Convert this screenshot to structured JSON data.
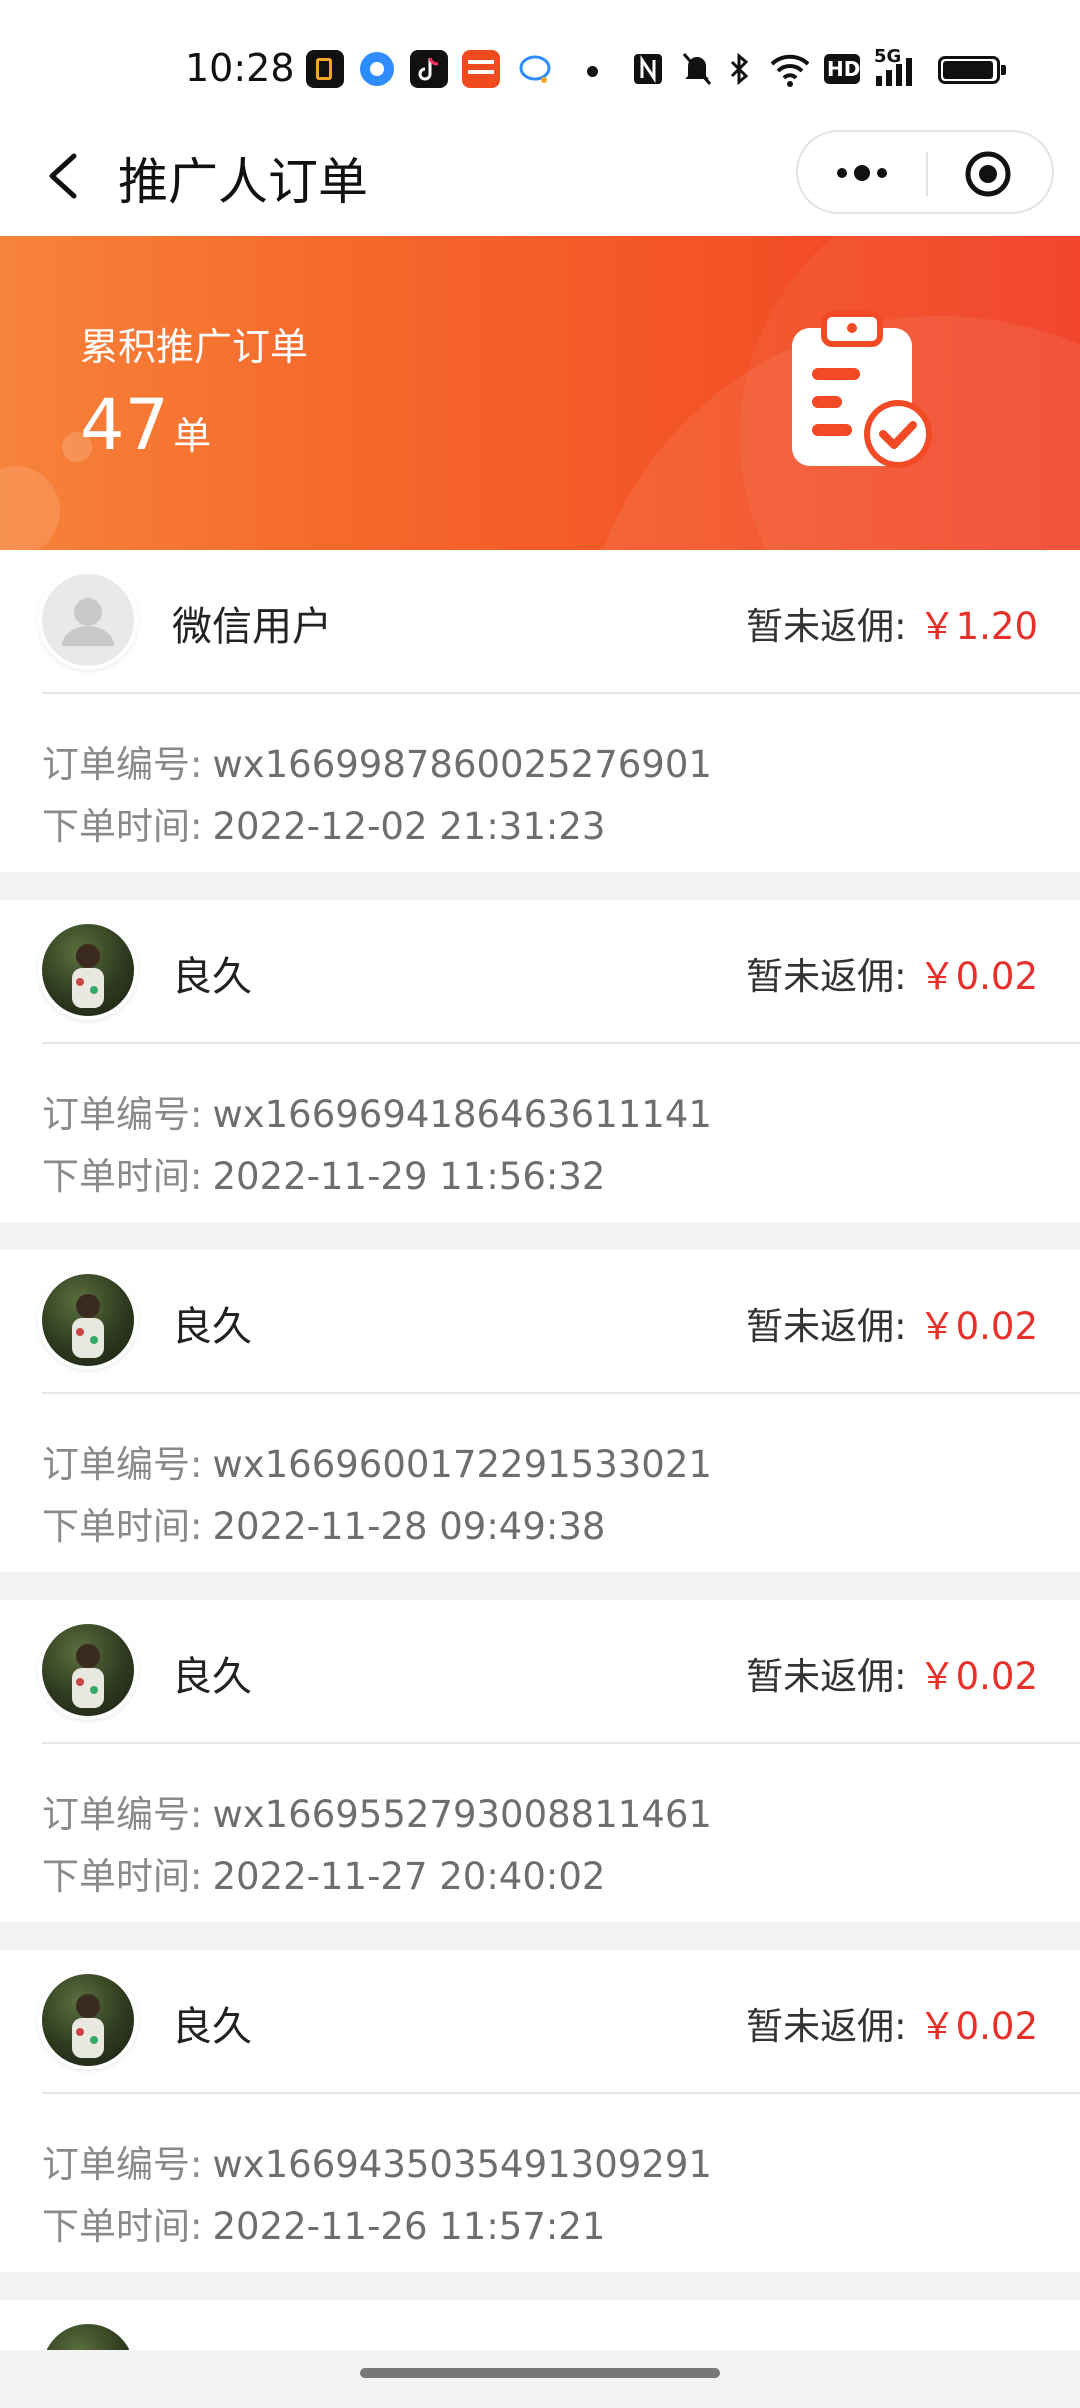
{
  "status_bar": {
    "time": "10:28",
    "icons": [
      "notification-app-icon",
      "browser-app-icon",
      "tiktok-app-icon",
      "bank-app-icon",
      "chat-app-icon",
      "dot-icon",
      "nfc-icon",
      "mute-icon",
      "bluetooth-icon",
      "wifi-icon",
      "hd-icon",
      "signal-5g-icon",
      "battery-icon"
    ],
    "hd_label": "HD",
    "signal_label": "5G"
  },
  "navbar": {
    "title": "推广人订单"
  },
  "banner": {
    "label": "累积推广订单",
    "count": "47",
    "unit": "单"
  },
  "orders": [
    {
      "user": "微信用户",
      "commission_label": "暂未返佣:",
      "amount": "￥1.20",
      "order_label": "订单编号:",
      "order_no": "wx1669987860025276901",
      "time_label": "下单时间:",
      "time": "2022-12-02 21:31:23",
      "avatar": "default"
    },
    {
      "user": "良久",
      "commission_label": "暂未返佣:",
      "amount": "￥0.02",
      "order_label": "订单编号:",
      "order_no": "wx1669694186463611141",
      "time_label": "下单时间:",
      "time": "2022-11-29 11:56:32",
      "avatar": "photo"
    },
    {
      "user": "良久",
      "commission_label": "暂未返佣:",
      "amount": "￥0.02",
      "order_label": "订单编号:",
      "order_no": "wx1669600172291533021",
      "time_label": "下单时间:",
      "time": "2022-11-28 09:49:38",
      "avatar": "photo"
    },
    {
      "user": "良久",
      "commission_label": "暂未返佣:",
      "amount": "￥0.02",
      "order_label": "订单编号:",
      "order_no": "wx1669552793008811461",
      "time_label": "下单时间:",
      "time": "2022-11-27 20:40:02",
      "avatar": "photo"
    },
    {
      "user": "良久",
      "commission_label": "暂未返佣:",
      "amount": "￥0.02",
      "order_label": "订单编号:",
      "order_no": "wx1669435035491309291",
      "time_label": "下单时间:",
      "time": "2022-11-26 11:57:21",
      "avatar": "photo"
    }
  ],
  "colors": {
    "accent_red": "#e8302a",
    "banner_start": "#f7833a",
    "banner_end": "#f23d22"
  }
}
